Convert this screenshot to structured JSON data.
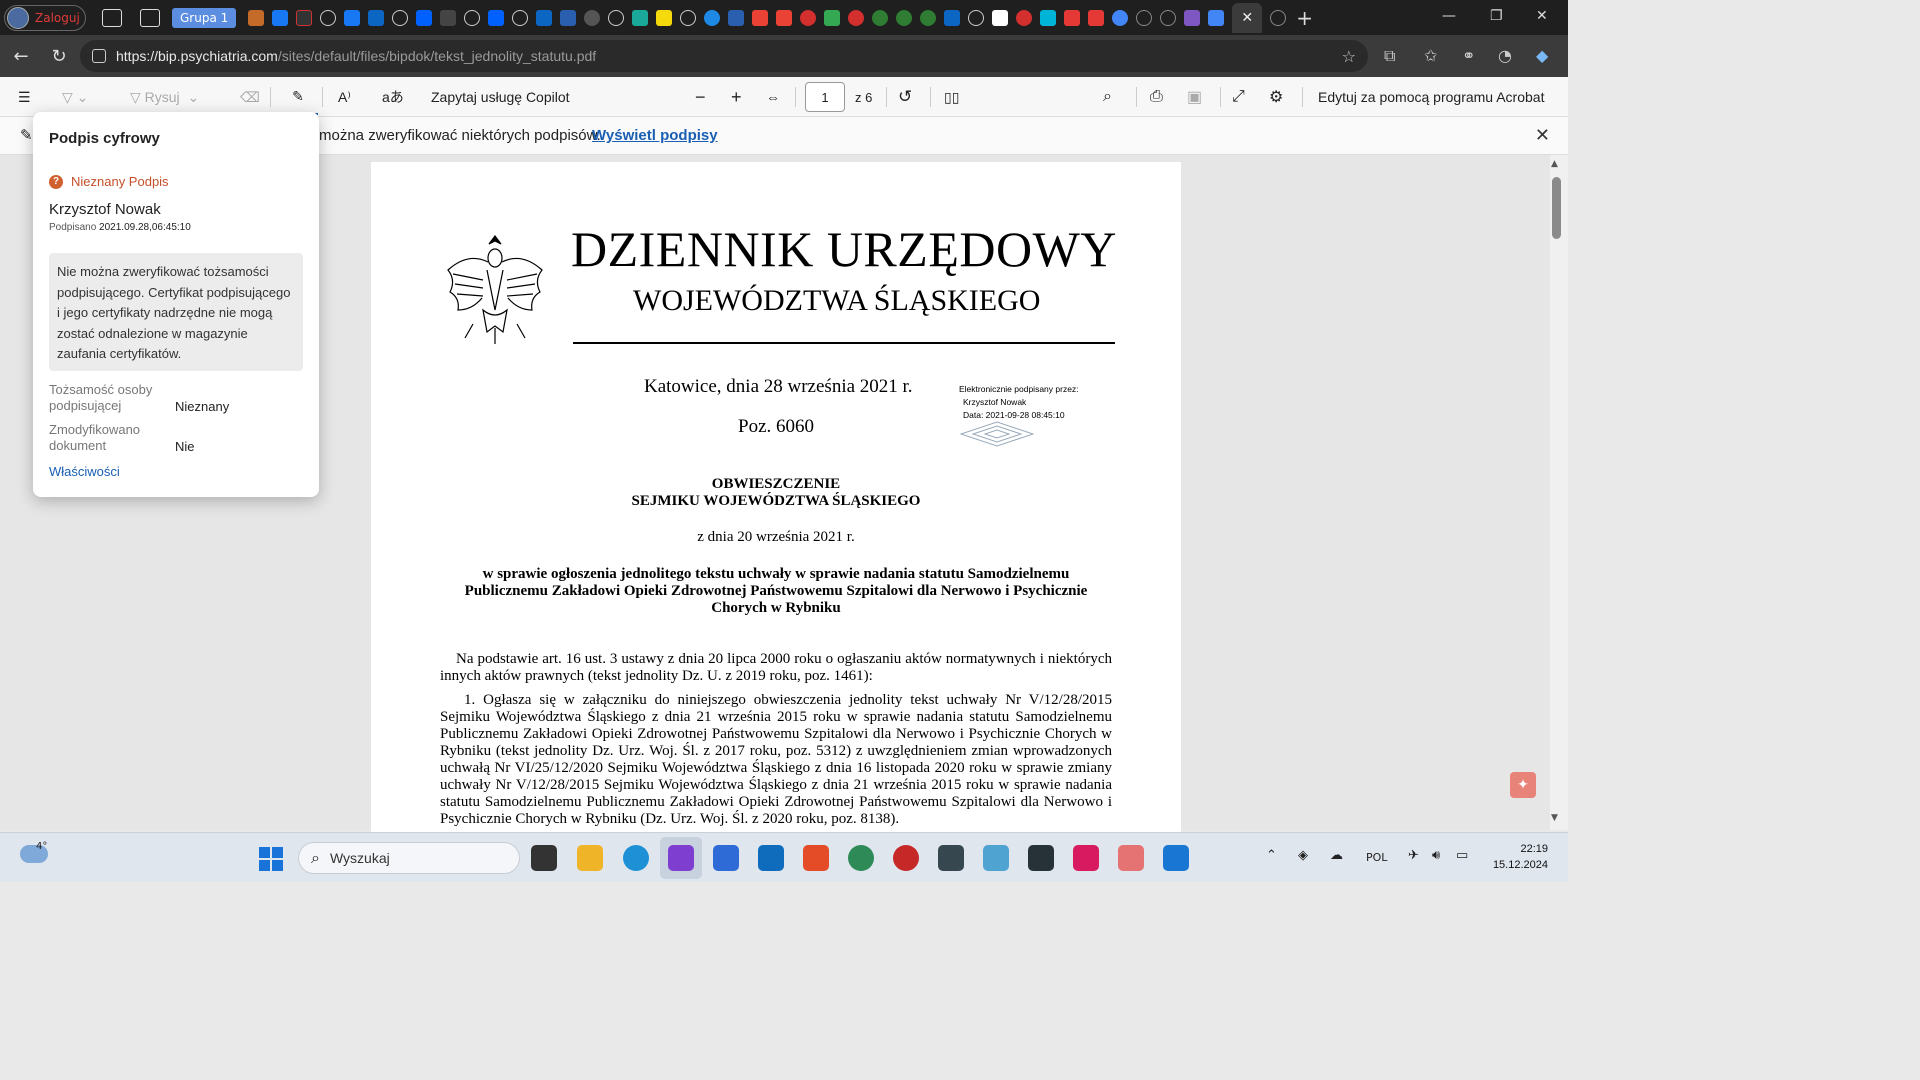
{
  "browser": {
    "profile_label": "Zaloguj",
    "tab_group_label": "Grupa 1",
    "url_host": "https://bip.psychiatria.com",
    "url_path": "/sites/default/files/bipdok/tekst_jednolity_statutu.pdf"
  },
  "pdf_toolbar": {
    "draw_label": "Rysuj",
    "copilot_label": "Zapytaj usługę Copilot",
    "page_current": "1",
    "page_total": "z 6",
    "acrobat_label": "Edytuj za pomocą programu Acrobat"
  },
  "infobar": {
    "message": "można zweryfikować niektórych podpisów.",
    "link": "Wyświetl podpisy"
  },
  "signature_panel": {
    "title": "Podpis cyfrowy",
    "status": "Nieznany Podpis",
    "signer": "Krzysztof Nowak",
    "signed_label": "Podpisano",
    "signed_value": "2021.09.28,06:45:10",
    "warning": "Nie można zweryfikować tożsamości podpisującego. Certyfikat podpisującego i jego certyfikaty nadrzędne nie mogą zostać odnalezione w magazynie zaufania certyfikatów.",
    "identity_label": "Tożsamość osoby podpisującej",
    "identity_value": "Nieznany",
    "modified_label": "Zmodyfikowano dokument",
    "modified_value": "Nie",
    "properties_link": "Właściwości"
  },
  "document": {
    "title": "DZIENNIK URZĘDOWY",
    "subtitle": "WOJEWÓDZTWA ŚLĄSKIEGO",
    "place_date": "Katowice, dnia 28 września 2021 r.",
    "position": "Poz. 6060",
    "esig_line1": "Elektronicznie podpisany przez:",
    "esig_line2": "Krzysztof Nowak",
    "esig_line3": "Data: 2021-09-28 08:45:10",
    "heading1": "OBWIESZCZENIE",
    "heading2": "SEJMIKU WOJEWÓDZTWA ŚLĄSKIEGO",
    "date_line": "z dnia 20 września 2021 r.",
    "subject": "w sprawie ogłoszenia jednolitego tekstu uchwały w sprawie nadania statutu Samodzielnemu Publicznemu Zakładowi Opieki Zdrowotnej Państwowemu Szpitalowi dla Nerwowo i Psychicznie Chorych w Rybniku",
    "para1": "Na podstawie art. 16 ust. 3 ustawy z dnia 20 lipca 2000 roku o ogłaszaniu aktów normatywnych i niektórych innych aktów prawnych (tekst jednolity Dz. U. z 2019 roku, poz. 1461):",
    "para2": "1. Ogłasza się w załączniku do niniejszego obwieszczenia jednolity tekst uchwały Nr V/12/28/2015 Sejmiku Województwa Śląskiego z dnia 21 września 2015 roku w sprawie nadania statutu Samodzielnemu Publicznemu Zakładowi Opieki Zdrowotnej Państwowemu Szpitalowi dla Nerwowo i Psychicznie Chorych w Rybniku (tekst jednolity Dz. Urz. Woj. Śl. z 2017 roku, poz. 5312) z uwzględnieniem zmian wprowadzonych uchwałą Nr VI/25/12/2020 Sejmiku Województwa Śląskiego z dnia 16 listopada 2020 roku w sprawie zmiany uchwały Nr V/12/28/2015 Sejmiku Województwa Śląskiego z dnia 21 września 2015 roku w sprawie nadania statutu Samodzielnemu Publicznemu Zakładowi Opieki Zdrowotnej Państwowemu Szpitalowi dla Nerwowo i Psychicznie Chorych w Rybniku (Dz. Urz. Woj. Śl. z 2020 roku, poz. 8138)."
  },
  "taskbar": {
    "temperature": "4°",
    "search_placeholder": "Wyszukaj",
    "language": "POL",
    "time": "22:19",
    "date": "15.12.2024"
  }
}
